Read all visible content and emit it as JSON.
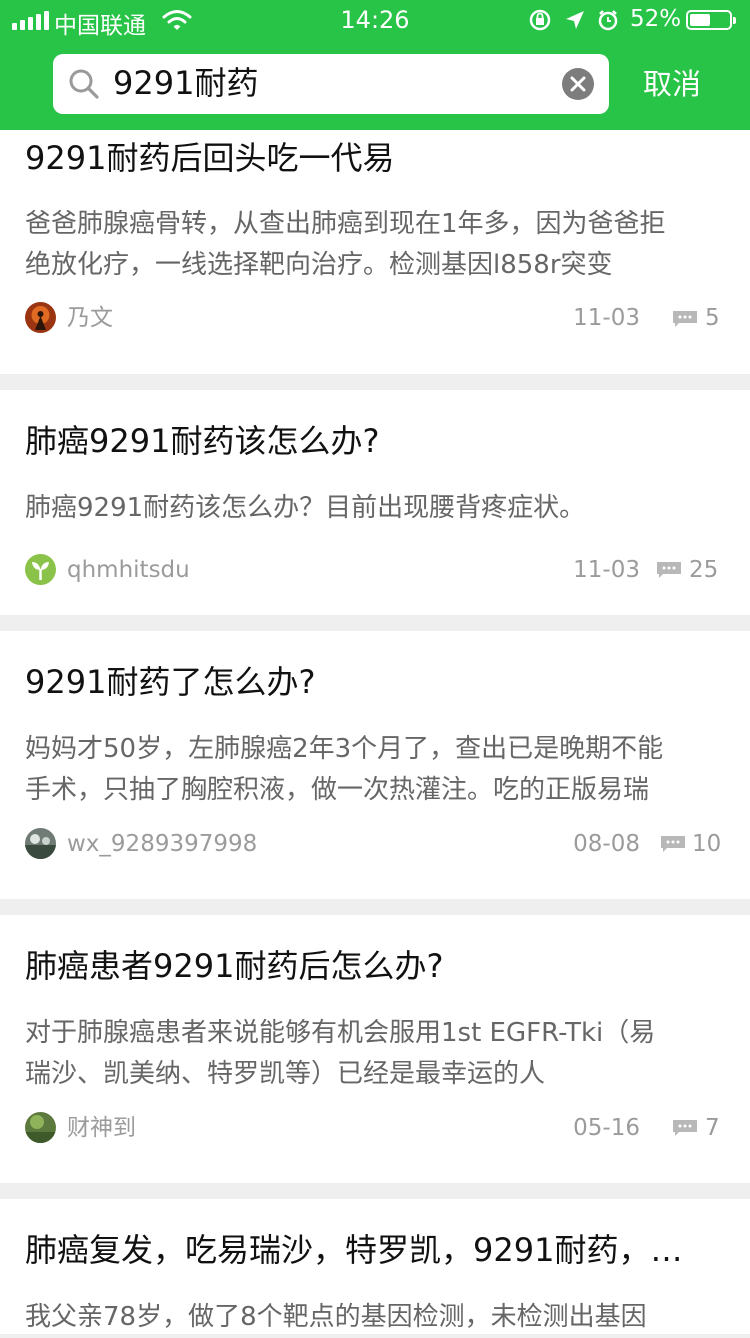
{
  "status_bar": {
    "carrier": "中国联通",
    "time": "14:26",
    "battery": "52%",
    "battery_level": 0.52
  },
  "search": {
    "query": "9291耐药",
    "cancel_label": "取消"
  },
  "results": [
    {
      "title": "9291耐药后回头吃一代易",
      "desc_lines": [
        "爸爸肺腺癌骨转，从查出肺癌到现在1年多，因为爸爸拒",
        "绝放化疗，一线选择靶向治疗。检测基因l858r突变"
      ],
      "author": "乃文",
      "date": "11-03",
      "comments": "5"
    },
    {
      "title": "肺癌9291耐药该怎么办?",
      "desc_lines": [
        "肺癌9291耐药该怎么办？目前出现腰背疼症状。"
      ],
      "author": "qhmhitsdu",
      "date": "11-03",
      "comments": "25"
    },
    {
      "title": "9291耐药了怎么办?",
      "desc_lines": [
        "妈妈才50岁，左肺腺癌2年3个月了，查出已是晚期不能",
        "手术，只抽了胸腔积液，做一次热灌注。吃的正版易瑞"
      ],
      "author": "wx_9289397998",
      "date": "08-08",
      "comments": "10"
    },
    {
      "title": "肺癌患者9291耐药后怎么办?",
      "desc_lines": [
        "对于肺腺癌患者来说能够有机会服用1st EGFR-Tki（易",
        "瑞沙、凯美纳、特罗凯等）已经是最幸运的人"
      ],
      "author": "财神到",
      "date": "05-16",
      "comments": "7"
    },
    {
      "title": "肺癌复发，吃易瑞沙，特罗凯，9291耐药，…",
      "desc_lines": [
        "我父亲78岁，做了8个靶点的基因检测，未检测出基因"
      ],
      "author": "",
      "date": "",
      "comments": ""
    }
  ]
}
